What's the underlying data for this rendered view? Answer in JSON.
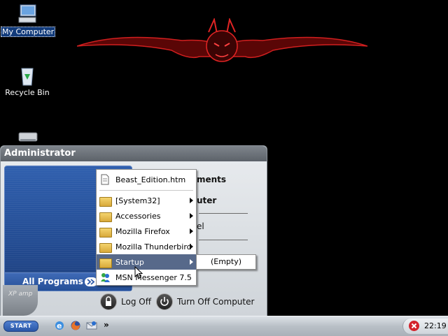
{
  "desktop": {
    "icons": [
      {
        "label": "My Computer",
        "icon": "computer-icon"
      },
      {
        "label": "Recycle Bin",
        "icon": "recycle-bin-icon"
      },
      {
        "label": "",
        "icon": "drive-icon"
      }
    ],
    "wallpaper": "red-demon-wings"
  },
  "start_menu": {
    "user": "Administrator",
    "all_programs_label": "All Programs",
    "right_partial": [
      "ments",
      "uter",
      "el"
    ],
    "logo_text": "XP amp",
    "log_off_label": "Log Off",
    "turn_off_label": "Turn Off Computer"
  },
  "programs_menu": {
    "items": [
      {
        "label": "Beast_Edition.htm",
        "icon": "document-icon",
        "submenu": false
      },
      {
        "label": "[System32]",
        "icon": "folder-icon",
        "submenu": true
      },
      {
        "label": "Accessories",
        "icon": "folder-icon",
        "submenu": true
      },
      {
        "label": "Mozilla Firefox",
        "icon": "folder-icon",
        "submenu": true
      },
      {
        "label": "Mozilla Thunderbird",
        "icon": "folder-icon",
        "submenu": true
      },
      {
        "label": "Startup",
        "icon": "folder-icon",
        "submenu": true,
        "highlighted": true
      },
      {
        "label": "MSN Messenger 7.5",
        "icon": "msn-icon",
        "submenu": false
      }
    ]
  },
  "startup_submenu": {
    "items": [
      {
        "label": "(Empty)"
      }
    ]
  },
  "taskbar": {
    "start_label": "START",
    "quick_launch": [
      "ie-icon",
      "firefox-icon",
      "thunderbird-icon"
    ],
    "more_label": "»",
    "clock": "22:19"
  },
  "colors": {
    "highlight": "#57698a",
    "start_left_panel": "#2a5599",
    "wallpaper_red": "#d11f1f"
  }
}
